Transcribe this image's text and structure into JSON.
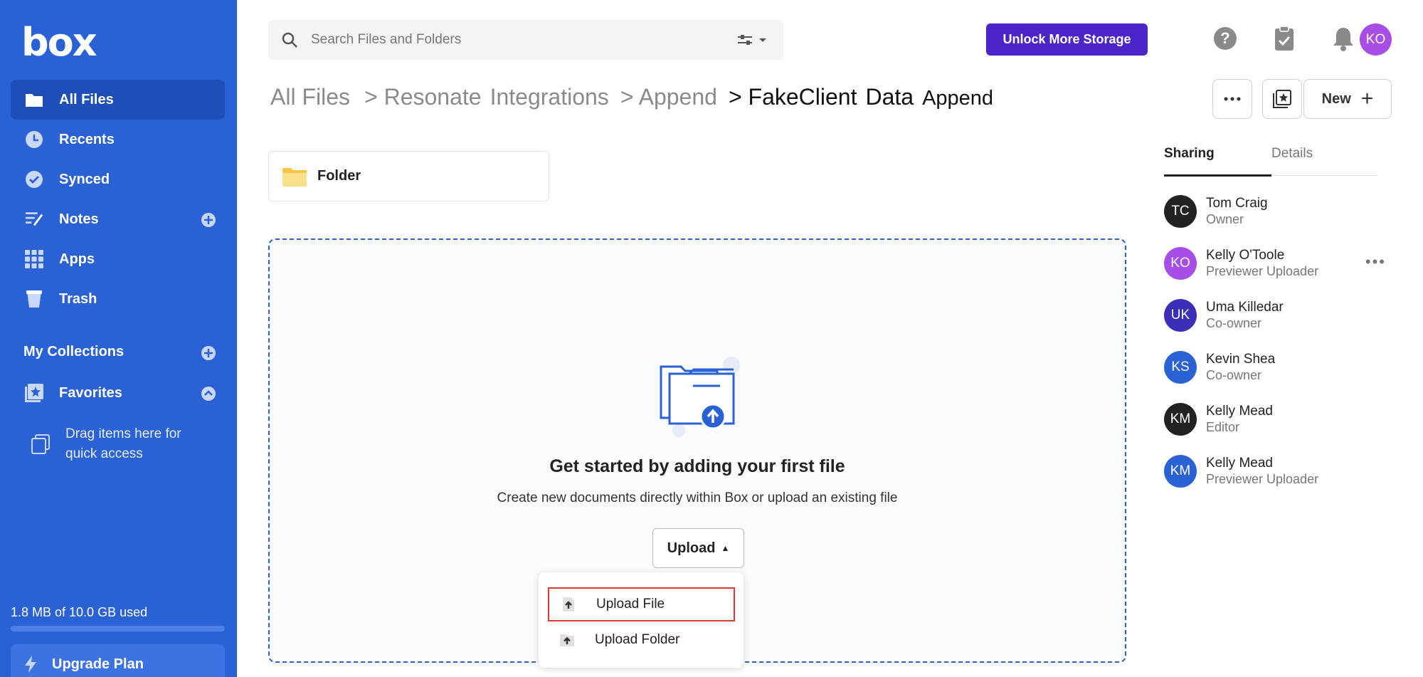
{
  "sidebar": {
    "logo": "box",
    "nav": [
      {
        "label": "All Files",
        "icon": "folder-icon",
        "active": true
      },
      {
        "label": "Recents",
        "icon": "clock-icon"
      },
      {
        "label": "Synced",
        "icon": "check-circle-icon"
      },
      {
        "label": "Notes",
        "icon": "notes-icon"
      },
      {
        "label": "Apps",
        "icon": "grid-icon"
      },
      {
        "label": "Trash",
        "icon": "trash-icon"
      }
    ],
    "collections_label": "My Collections",
    "favorites_label": "Favorites",
    "drag_hint": "Drag items here for quick access",
    "storage_text": "1.8 MB of 10.0 GB used",
    "storage_fraction": 0.0002,
    "upgrade_label": "Upgrade Plan"
  },
  "topbar": {
    "search_placeholder": "Search Files and Folders",
    "unlock_label": "Unlock More Storage",
    "avatar_initials": "KO"
  },
  "breadcrumb": {
    "items": [
      "All Files",
      "> Resonate",
      "Integrations",
      "> Append",
      "> FakeClient",
      "Data",
      "Append"
    ]
  },
  "actions": {
    "new_label": "New"
  },
  "folder_card": {
    "label": "Folder"
  },
  "dropzone": {
    "title": "Get started by adding your first file",
    "subtitle": "Create new documents directly within Box or upload an existing file",
    "upload_label": "Upload"
  },
  "upload_menu": {
    "items": [
      "Upload File",
      "Upload Folder"
    ]
  },
  "panel": {
    "tabs": [
      "Sharing",
      "Details"
    ],
    "people": [
      {
        "initials": "TC",
        "name": "Tom Craig",
        "role": "Owner",
        "color": "#222222"
      },
      {
        "initials": "KO",
        "name": "Kelly O'Toole",
        "role": "Previewer Uploader",
        "color": "#a64ee6"
      },
      {
        "initials": "UK",
        "name": "Uma Killedar",
        "role": "Co-owner",
        "color": "#3b2fb8"
      },
      {
        "initials": "KS",
        "name": "Kevin Shea",
        "role": "Co-owner",
        "color": "#2a62d6"
      },
      {
        "initials": "KM",
        "name": "Kelly Mead",
        "role": "Editor",
        "color": "#222222"
      },
      {
        "initials": "KM",
        "name": "Kelly Mead",
        "role": "Previewer Uploader",
        "color": "#2a62d6"
      }
    ]
  },
  "colors": {
    "sidebar": "#2a62d6",
    "accent": "#4b25c7",
    "highlight": "#e03c2e"
  }
}
